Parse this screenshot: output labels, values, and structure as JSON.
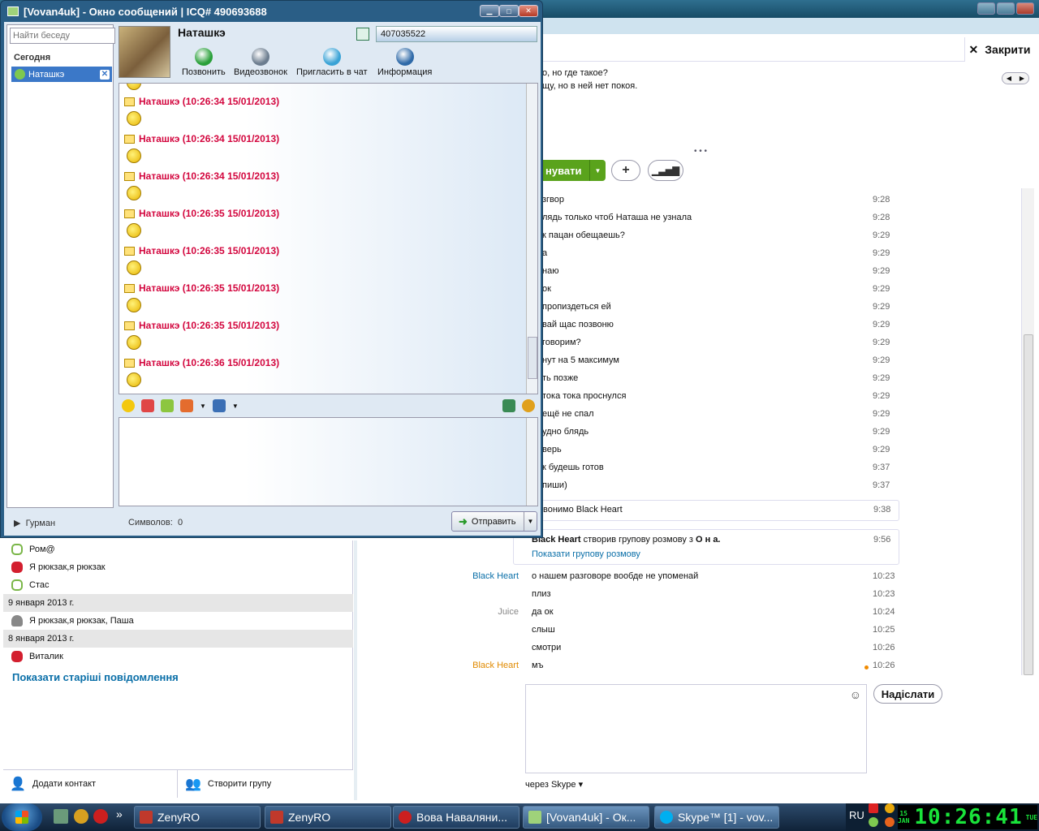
{
  "skype": {
    "close_label": "Закрити",
    "mood_line1": "о, но где такое?",
    "mood_line2": "щу, но в ней нет покоя.",
    "call_label": "нувати",
    "messages": [
      {
        "who": "",
        "text": "згвор",
        "time": "9:28"
      },
      {
        "who": "",
        "text": "лядь только чтоб Наташа не узнала",
        "time": "9:28"
      },
      {
        "who": "",
        "text": "к пацан обещаешь?",
        "time": "9:29"
      },
      {
        "who": "",
        "text": "а",
        "time": "9:29"
      },
      {
        "who": "",
        "text": "наю",
        "time": "9:29"
      },
      {
        "who": "",
        "text": "ок",
        "time": "9:29"
      },
      {
        "who": "",
        "text": "пропиздеться ей",
        "time": "9:29"
      },
      {
        "who": "",
        "text": "вай щас позвоню",
        "time": "9:29"
      },
      {
        "who": "",
        "text": "говорим?",
        "time": "9:29"
      },
      {
        "who": "",
        "text": "нут на 5 максимум",
        "time": "9:29"
      },
      {
        "who": "",
        "text": "ть позже",
        "time": "9:29"
      },
      {
        "who": "",
        "text": "тока тока проснулся",
        "time": "9:29"
      },
      {
        "who": "",
        "text": "ещё не спал",
        "time": "9:29"
      },
      {
        "who": "",
        "text": "удно блядь",
        "time": "9:29"
      },
      {
        "who": "",
        "text": "верь",
        "time": "9:29"
      },
      {
        "who": "",
        "text": "к будешь готов",
        "time": "9:37"
      },
      {
        "who": "",
        "text": "пиши)",
        "time": "9:37"
      }
    ],
    "call_event": {
      "text": "вонимо Black Heart",
      "time": "9:38"
    },
    "group_event": {
      "author": "Black Heart",
      "text": "створив групову розмову з",
      "target": "О н а.",
      "time": "9:56",
      "link": "Показати групову розмову"
    },
    "late_messages": [
      {
        "who": "Black Heart",
        "text": "о нашем разговоре вообде не упоменай",
        "time": "10:23"
      },
      {
        "who": "",
        "text": "плиз",
        "time": "10:23"
      },
      {
        "who": "Juice",
        "text": "да ок",
        "time": "10:24"
      },
      {
        "who": "",
        "text": "слыш",
        "time": "10:25"
      },
      {
        "who": "",
        "text": "смотри",
        "time": "10:26"
      },
      {
        "who": "Black Heart",
        "text": "мъ",
        "time": "10:26"
      }
    ],
    "send_label": "Надіслати",
    "via_label": "через Skype",
    "contacts": [
      {
        "type": "contact",
        "name": "Ром@",
        "status": "offline"
      },
      {
        "type": "contact",
        "name": "Я рюкзак,я рюкзак",
        "status": "blocked"
      },
      {
        "type": "contact",
        "name": "Стас",
        "status": "offline"
      },
      {
        "type": "date",
        "name": "9 января 2013 г."
      },
      {
        "type": "group",
        "name": "Я рюкзак,я рюкзак, Паша",
        "status": "group"
      },
      {
        "type": "date",
        "name": "8 января 2013 г."
      },
      {
        "type": "contact",
        "name": "Виталик",
        "status": "blocked"
      }
    ],
    "older_label": "Показати старіші повідомлення",
    "add_contact_label": "Додати контакт",
    "create_group_label": "Створити групу"
  },
  "icq": {
    "title": "[Vovan4uk] - Окно сообщений | ICQ# 490693688",
    "search_placeholder": "Найти беседу",
    "today_label": "Сегодня",
    "selected_contact": "Наташкэ",
    "group_label": "Гурман",
    "contact_name": "Наташкэ",
    "uin": "407035522",
    "actions": [
      {
        "label": "Позвонить",
        "icon": "phone-icon",
        "color": "#2aa03a"
      },
      {
        "label": "Видеозвонок",
        "icon": "webcam-icon",
        "color": "#6c7d8f"
      },
      {
        "label": "Пригласить в чат",
        "icon": "invite-chat-icon",
        "color": "#3aa3d6"
      },
      {
        "label": "Информация",
        "icon": "info-card-icon",
        "color": "#2f6aa8"
      }
    ],
    "history": [
      {
        "header": "Наташкэ (10:26:34 15/01/2013)"
      },
      {
        "header": "Наташкэ (10:26:34 15/01/2013)"
      },
      {
        "header": "Наташкэ (10:26:34 15/01/2013)"
      },
      {
        "header": "Наташкэ (10:26:35 15/01/2013)"
      },
      {
        "header": "Наташкэ (10:26:35 15/01/2013)"
      },
      {
        "header": "Наташкэ (10:26:35 15/01/2013)"
      },
      {
        "header": "Наташкэ (10:26:35 15/01/2013)"
      },
      {
        "header": "Наташкэ (10:26:36 15/01/2013)"
      }
    ],
    "chars_label": "Символов:",
    "chars_count": "0",
    "send_label": "Отправить"
  },
  "taskbar": {
    "items": [
      {
        "label": "ZenyRO",
        "icon": "zenyro-icon",
        "active": false
      },
      {
        "label": "ZenyRO",
        "icon": "zenyro-icon",
        "active": false
      },
      {
        "label": "Вова Наваляни...",
        "icon": "opera-icon",
        "active": false
      },
      {
        "label": "[Vovan4uk] - Ок...",
        "icon": "icq-window-icon",
        "active": true
      },
      {
        "label": "Skype™ [1] - vov...",
        "icon": "skype-icon",
        "active": true
      }
    ],
    "lang": "RU",
    "clock": "10:26:41",
    "date_day": "15",
    "date_month": "JAN",
    "weekday": "TUE"
  }
}
